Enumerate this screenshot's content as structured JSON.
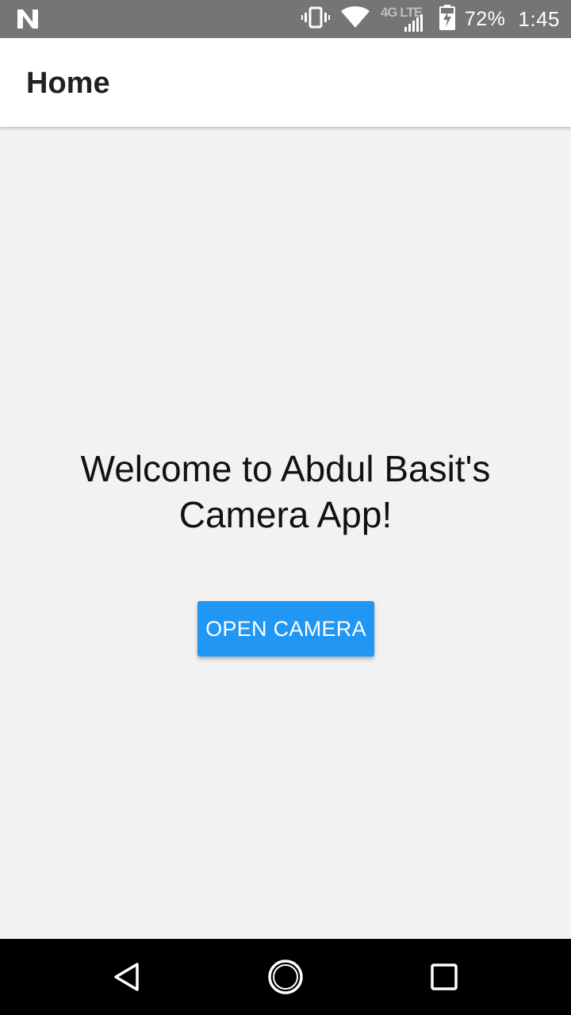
{
  "status_bar": {
    "notification_icon": "n-icon",
    "vibrate_icon": "vibrate-icon",
    "wifi_icon": "wifi-icon",
    "network_label": "4G LTE",
    "signal_icon": "signal-icon",
    "battery_icon": "battery-charging-icon",
    "battery_percent": "72%",
    "time": "1:45"
  },
  "app_bar": {
    "title": "Home"
  },
  "main": {
    "welcome_line1": "Welcome to Abdul Basit's",
    "welcome_line2": "Camera App!",
    "open_camera_label": "OPEN CAMERA"
  },
  "nav_bar": {
    "back_icon": "back-icon",
    "home_icon": "home-icon",
    "recents_icon": "recents-icon"
  },
  "colors": {
    "status_bar_bg": "#757575",
    "app_bar_bg": "#ffffff",
    "content_bg": "#f2f2f2",
    "button_bg": "#2196f3",
    "button_text": "#ffffff",
    "nav_bar_bg": "#000000"
  }
}
